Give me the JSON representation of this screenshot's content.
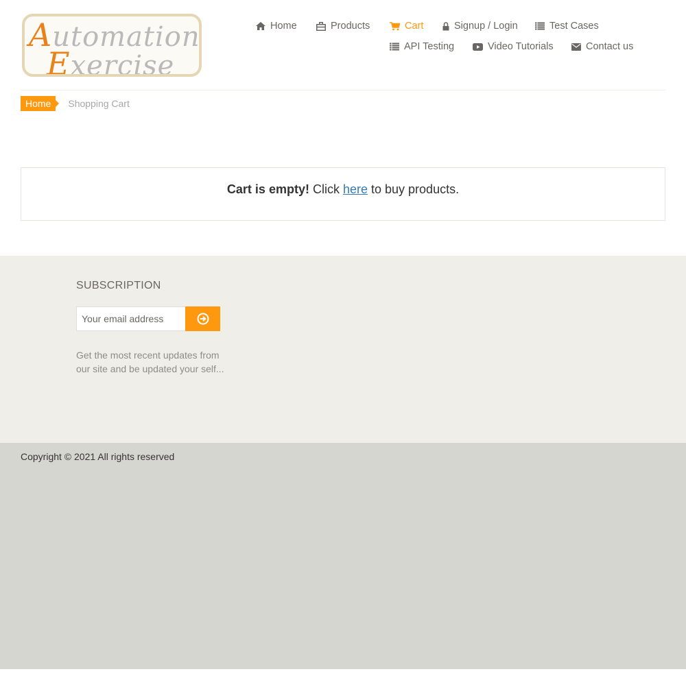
{
  "logo": {
    "word1_cap": "A",
    "word1_rest": "utomation",
    "word2_cap": "E",
    "word2_rest": "xercise"
  },
  "nav": {
    "items": [
      {
        "label": "Home",
        "icon": "home-icon"
      },
      {
        "label": "Products",
        "icon": "briefcase-icon"
      },
      {
        "label": "Cart",
        "icon": "shopping-cart-icon",
        "active": true
      },
      {
        "label": "Signup / Login",
        "icon": "lock-icon"
      },
      {
        "label": "Test Cases",
        "icon": "list-icon"
      },
      {
        "label": "API Testing",
        "icon": "list-icon"
      },
      {
        "label": "Video Tutorials",
        "icon": "youtube-play-icon"
      },
      {
        "label": "Contact us",
        "icon": "envelope-icon"
      }
    ]
  },
  "breadcrumb": {
    "home": "Home",
    "current": "Shopping Cart"
  },
  "cart": {
    "empty_bold": "Cart is empty!",
    "prefix": " Click ",
    "link": "here",
    "suffix": " to buy products."
  },
  "subscription": {
    "title": "SUBSCRIPTION",
    "placeholder": "Your email address",
    "button_icon": "arrow-circle-right-icon",
    "description": "Get the most recent updates from our site and be updated your self..."
  },
  "footer": {
    "copyright": "Copyright © 2021 All rights reserved"
  },
  "colors": {
    "accent": "#fe980f",
    "link": "#337ab7",
    "text": "#696763",
    "footer_widget_bg": "#f0eee8",
    "footer_bottom_bg": "#d6d6d0"
  }
}
